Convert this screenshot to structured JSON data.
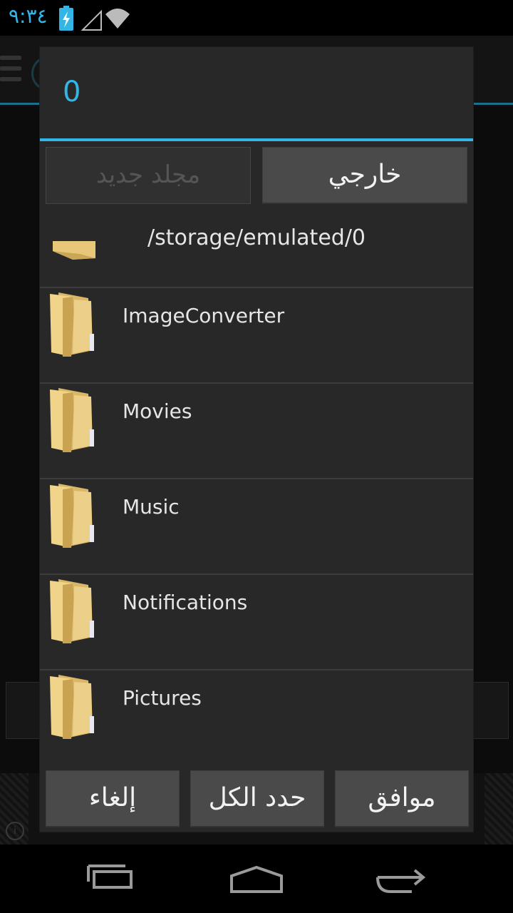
{
  "status_bar": {
    "time": "٩:٣٤",
    "icons": [
      "battery-charging-icon",
      "signal-empty-icon",
      "wifi-icon"
    ]
  },
  "dialog": {
    "title": "0",
    "buttons": {
      "external": "خارجي",
      "new_folder": "مجلد جديد"
    },
    "path": "/storage/emulated/0",
    "folders": [
      {
        "name": "ImageConverter"
      },
      {
        "name": "Movies"
      },
      {
        "name": "Music"
      },
      {
        "name": "Notifications"
      },
      {
        "name": "Pictures"
      }
    ],
    "footer": {
      "ok": "موافق",
      "select_all": "حدد الكل",
      "cancel": "إلغاء"
    }
  },
  "nav_bar": {
    "icons": [
      "recent-apps-icon",
      "home-icon",
      "back-icon"
    ]
  },
  "colors": {
    "accent": "#33b5e5",
    "dialog_bg": "#282828",
    "button_bg": "#4a4a4a",
    "folder": "#e8c878"
  }
}
